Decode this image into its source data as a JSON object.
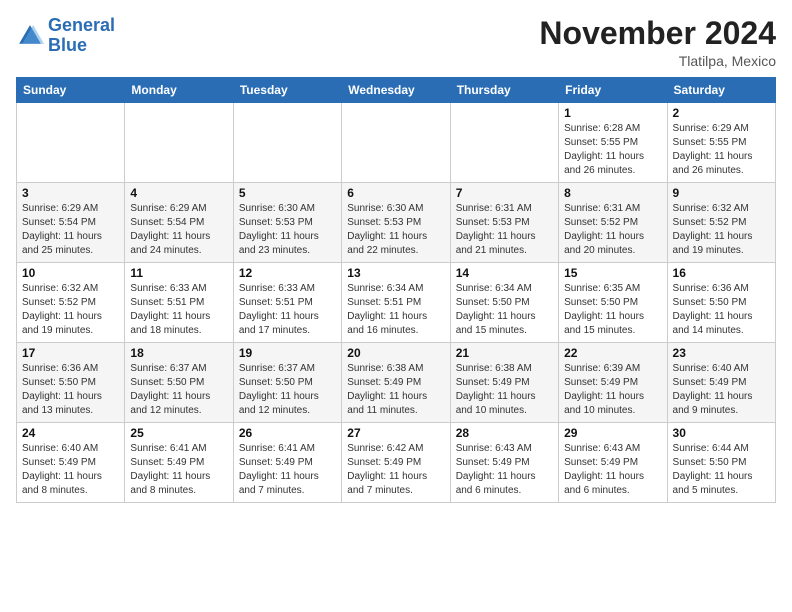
{
  "header": {
    "logo_text_general": "General",
    "logo_text_blue": "Blue",
    "month_title": "November 2024",
    "location": "Tlatilpa, Mexico"
  },
  "calendar": {
    "days_of_week": [
      "Sunday",
      "Monday",
      "Tuesday",
      "Wednesday",
      "Thursday",
      "Friday",
      "Saturday"
    ],
    "weeks": [
      [
        {
          "day": "",
          "info": ""
        },
        {
          "day": "",
          "info": ""
        },
        {
          "day": "",
          "info": ""
        },
        {
          "day": "",
          "info": ""
        },
        {
          "day": "",
          "info": ""
        },
        {
          "day": "1",
          "info": "Sunrise: 6:28 AM\nSunset: 5:55 PM\nDaylight: 11 hours and 26 minutes."
        },
        {
          "day": "2",
          "info": "Sunrise: 6:29 AM\nSunset: 5:55 PM\nDaylight: 11 hours and 26 minutes."
        }
      ],
      [
        {
          "day": "3",
          "info": "Sunrise: 6:29 AM\nSunset: 5:54 PM\nDaylight: 11 hours and 25 minutes."
        },
        {
          "day": "4",
          "info": "Sunrise: 6:29 AM\nSunset: 5:54 PM\nDaylight: 11 hours and 24 minutes."
        },
        {
          "day": "5",
          "info": "Sunrise: 6:30 AM\nSunset: 5:53 PM\nDaylight: 11 hours and 23 minutes."
        },
        {
          "day": "6",
          "info": "Sunrise: 6:30 AM\nSunset: 5:53 PM\nDaylight: 11 hours and 22 minutes."
        },
        {
          "day": "7",
          "info": "Sunrise: 6:31 AM\nSunset: 5:53 PM\nDaylight: 11 hours and 21 minutes."
        },
        {
          "day": "8",
          "info": "Sunrise: 6:31 AM\nSunset: 5:52 PM\nDaylight: 11 hours and 20 minutes."
        },
        {
          "day": "9",
          "info": "Sunrise: 6:32 AM\nSunset: 5:52 PM\nDaylight: 11 hours and 19 minutes."
        }
      ],
      [
        {
          "day": "10",
          "info": "Sunrise: 6:32 AM\nSunset: 5:52 PM\nDaylight: 11 hours and 19 minutes."
        },
        {
          "day": "11",
          "info": "Sunrise: 6:33 AM\nSunset: 5:51 PM\nDaylight: 11 hours and 18 minutes."
        },
        {
          "day": "12",
          "info": "Sunrise: 6:33 AM\nSunset: 5:51 PM\nDaylight: 11 hours and 17 minutes."
        },
        {
          "day": "13",
          "info": "Sunrise: 6:34 AM\nSunset: 5:51 PM\nDaylight: 11 hours and 16 minutes."
        },
        {
          "day": "14",
          "info": "Sunrise: 6:34 AM\nSunset: 5:50 PM\nDaylight: 11 hours and 15 minutes."
        },
        {
          "day": "15",
          "info": "Sunrise: 6:35 AM\nSunset: 5:50 PM\nDaylight: 11 hours and 15 minutes."
        },
        {
          "day": "16",
          "info": "Sunrise: 6:36 AM\nSunset: 5:50 PM\nDaylight: 11 hours and 14 minutes."
        }
      ],
      [
        {
          "day": "17",
          "info": "Sunrise: 6:36 AM\nSunset: 5:50 PM\nDaylight: 11 hours and 13 minutes."
        },
        {
          "day": "18",
          "info": "Sunrise: 6:37 AM\nSunset: 5:50 PM\nDaylight: 11 hours and 12 minutes."
        },
        {
          "day": "19",
          "info": "Sunrise: 6:37 AM\nSunset: 5:50 PM\nDaylight: 11 hours and 12 minutes."
        },
        {
          "day": "20",
          "info": "Sunrise: 6:38 AM\nSunset: 5:49 PM\nDaylight: 11 hours and 11 minutes."
        },
        {
          "day": "21",
          "info": "Sunrise: 6:38 AM\nSunset: 5:49 PM\nDaylight: 11 hours and 10 minutes."
        },
        {
          "day": "22",
          "info": "Sunrise: 6:39 AM\nSunset: 5:49 PM\nDaylight: 11 hours and 10 minutes."
        },
        {
          "day": "23",
          "info": "Sunrise: 6:40 AM\nSunset: 5:49 PM\nDaylight: 11 hours and 9 minutes."
        }
      ],
      [
        {
          "day": "24",
          "info": "Sunrise: 6:40 AM\nSunset: 5:49 PM\nDaylight: 11 hours and 8 minutes."
        },
        {
          "day": "25",
          "info": "Sunrise: 6:41 AM\nSunset: 5:49 PM\nDaylight: 11 hours and 8 minutes."
        },
        {
          "day": "26",
          "info": "Sunrise: 6:41 AM\nSunset: 5:49 PM\nDaylight: 11 hours and 7 minutes."
        },
        {
          "day": "27",
          "info": "Sunrise: 6:42 AM\nSunset: 5:49 PM\nDaylight: 11 hours and 7 minutes."
        },
        {
          "day": "28",
          "info": "Sunrise: 6:43 AM\nSunset: 5:49 PM\nDaylight: 11 hours and 6 minutes."
        },
        {
          "day": "29",
          "info": "Sunrise: 6:43 AM\nSunset: 5:49 PM\nDaylight: 11 hours and 6 minutes."
        },
        {
          "day": "30",
          "info": "Sunrise: 6:44 AM\nSunset: 5:50 PM\nDaylight: 11 hours and 5 minutes."
        }
      ]
    ]
  }
}
